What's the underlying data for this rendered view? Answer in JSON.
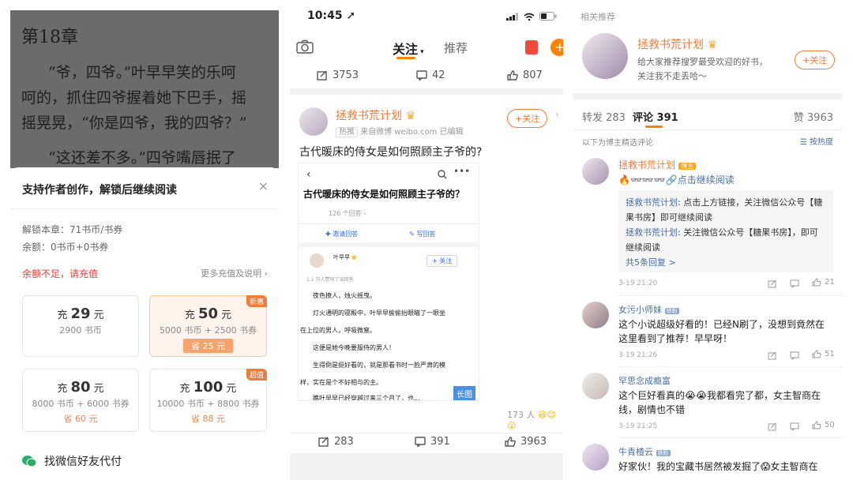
{
  "reader": {
    "chapter_title": "第18章",
    "para1_line1": "“爷，四爷。”叶早早笑的乐呵",
    "para1_line2": "呵的，抓住四爷握着她下巴手，摇",
    "para1_line3": "摇晃晃，“你是四爷，我的四爷？”",
    "para2_line1": "“这还差不多。”四爷嘴唇抿了"
  },
  "unlock": {
    "title": "支持作者创作，解锁后继续阅读",
    "chapter_price": "解锁本章：71书币/书券",
    "balance": "余额：0书币+0书券",
    "insufficient": "余额不足，请充值",
    "more_link": "更多充值及说明",
    "options": [
      {
        "prefix": "充",
        "amount": "29",
        "unit": "元",
        "detail": "2900 书币",
        "discount": ""
      },
      {
        "prefix": "充",
        "amount": "50",
        "unit": "元",
        "detail": "5000 书币 + 2500 书券",
        "discount": "省 25 元",
        "badge": "新惠"
      },
      {
        "prefix": "充",
        "amount": "80",
        "unit": "元",
        "detail": "8000 书币 + 6000 书券",
        "discount": "省 60 元"
      },
      {
        "prefix": "充",
        "amount": "100",
        "unit": "元",
        "detail": "10000 书币 + 8800 书券",
        "discount": "省 88 元",
        "badge": "超值"
      }
    ],
    "wechat_pay": "找微信好友代付"
  },
  "weibo": {
    "time": "10:45",
    "tab_follow": "关注",
    "tab_recommend": "推荐",
    "top_stats": {
      "repost": "3753",
      "comment": "42",
      "like": "807"
    },
    "author": "拯救书荒计划",
    "hot_tag": "热推",
    "source": "来自微博 weibo.com 已编辑",
    "follow_btn": "+关注",
    "post_text": "古代暖床的侍女是如何照顾主子爷的?",
    "inner": {
      "question": "古代暖床的侍女是如何照顾主子爷的？",
      "answers": "126 个回答 ›",
      "invite": "邀请回答",
      "write": "写回答",
      "user": "叶早早",
      "follow": "+ 关注",
      "likes_note": "1.1 万人赞同了该回答",
      "lines": [
        "夜色撩人，烛火摇曳。",
        "灯火通明的寝殿中，叶早早偷偷抬眼瞄了一眼坐",
        "在上位的男人，呼吸微窒。",
        "这便是她今晚要服侍的男人！",
        "生得倒是挺好看的，就是那看书时一脸严肃的模",
        "样，实在是个不好相与的主。",
        "瞧叶早早已经穿越过来三个月了，也..."
      ],
      "long_img": "长图"
    },
    "reactions": "173 人",
    "bottom_stats": {
      "repost": "283",
      "comment": "391",
      "like": "3963"
    }
  },
  "detail": {
    "related": "相关推荐",
    "name": "拯救书荒计划",
    "bio1": "给大家推荐搜罗最受欢迎的好书，",
    "bio2": "关注我不走丢哈～",
    "follow": "+关注",
    "tabs": {
      "repost": "转发 283",
      "comment": "评论 391",
      "like": "赞 3963"
    },
    "filter_note": "以下为博主精选评论",
    "sort": "按热度",
    "comments": [
      {
        "name": "拯救书荒计划",
        "tag": "博主",
        "text": "🔥👓👓👓🔗点击继续阅读",
        "replies": [
          {
            "name": "拯救书荒计划",
            "text": ": 点击上方链接，关注微信公众号【糖果书房】即可继续阅读"
          },
          {
            "name": "拯救书荒计划",
            "text": ": 关注微信公众号【糖果书房】，即可继续阅读"
          }
        ],
        "more": "共5条回复 >",
        "time": "3-19 21:20",
        "likes": "21"
      },
      {
        "name": "女污小师妹",
        "tag": "铁粉",
        "text": "这个小说超级好看的！已经N刷了，没想到竟然在这里看到了推荐！早早呀！",
        "time": "3-19 21:26",
        "likes": "51"
      },
      {
        "name": "罕思念成瘾富",
        "tag": "",
        "text": "这个巨好看真的😭😭我都看完了都，女主智商在线，剧情也不错",
        "time": "3-19 21:25",
        "likes": "50"
      },
      {
        "name": "牛青楂云",
        "tag": "铁粉",
        "text": "好家伙！我的宝藏书居然被发掘了😱女主智商在",
        "time": "",
        "likes": ""
      }
    ]
  },
  "colors": {
    "orange": "#f07c3c",
    "blue": "#4a6fa5",
    "weibo_orange": "#ff8200"
  }
}
